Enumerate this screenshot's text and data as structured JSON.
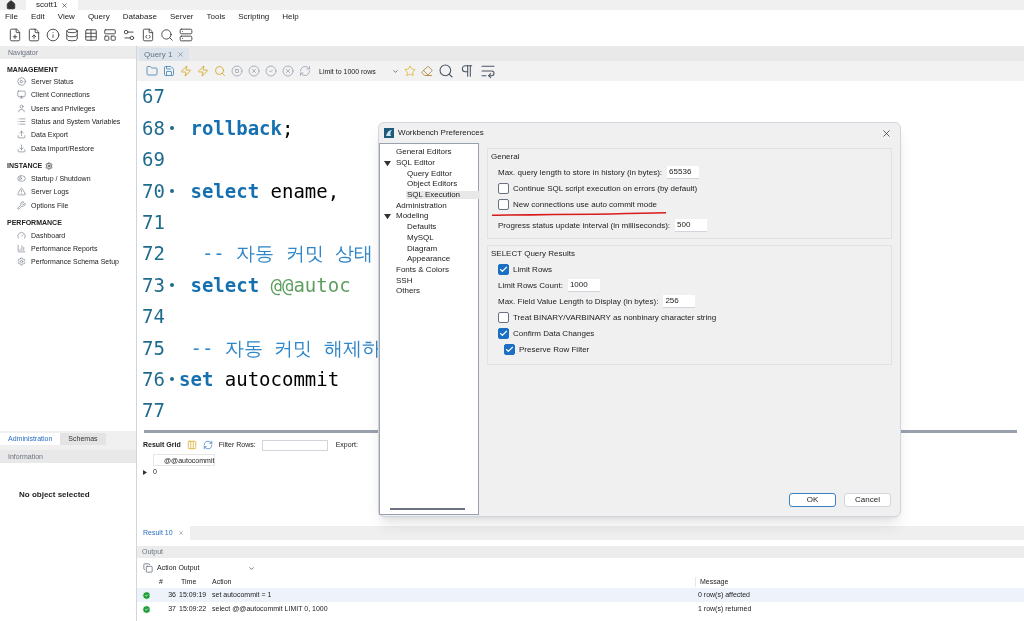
{
  "tabs": [
    {
      "label": "scott1",
      "selected": true
    }
  ],
  "menu": [
    "File",
    "Edit",
    "View",
    "Query",
    "Database",
    "Server",
    "Tools",
    "Scripting",
    "Help"
  ],
  "navigator": {
    "title": "Navigator",
    "sections": [
      {
        "title": "MANAGEMENT",
        "items": [
          "Server Status",
          "Client Connections",
          "Users and Privileges",
          "Status and System Variables",
          "Data Export",
          "Data Import/Restore"
        ]
      },
      {
        "title": "INSTANCE",
        "items": [
          "Startup / Shutdown",
          "Server Logs",
          "Options File"
        ]
      },
      {
        "title": "PERFORMANCE",
        "items": [
          "Dashboard",
          "Performance Reports",
          "Performance Schema Setup"
        ]
      }
    ]
  },
  "sidebar_tabs": [
    {
      "label": "Administration",
      "selected": true
    },
    {
      "label": "Schemas",
      "selected": false
    }
  ],
  "information": {
    "title": "Information",
    "text": "No object selected"
  },
  "query_tab": {
    "label": "Query 1"
  },
  "limit_select": {
    "value": "Limit to 1000 rows"
  },
  "code_lines": [
    {
      "number": "67",
      "marker": false
    },
    {
      "number": "68",
      "marker": true,
      "parts": [
        {
          "kind": "keyword",
          "text": " rollback"
        },
        {
          "kind": "plain",
          "text": ";"
        }
      ]
    },
    {
      "number": "69",
      "marker": false
    },
    {
      "number": "70",
      "marker": true,
      "parts": [
        {
          "kind": "keyword",
          "text": " select"
        },
        {
          "kind": "plain",
          "text": " ename,"
        }
      ]
    },
    {
      "number": "71",
      "marker": false
    },
    {
      "number": "72",
      "marker": false,
      "parts": [
        {
          "kind": "comment",
          "text": "  -- 자동 커밋 상태"
        }
      ]
    },
    {
      "number": "73",
      "marker": true,
      "parts": [
        {
          "kind": "keyword",
          "text": " select"
        },
        {
          "kind": "variable",
          "text": " @@autoc"
        }
      ]
    },
    {
      "number": "74",
      "marker": false
    },
    {
      "number": "75",
      "marker": false,
      "parts": [
        {
          "kind": "comment",
          "text": " -- 자동 커밋 해제하"
        }
      ]
    },
    {
      "number": "76",
      "marker": true,
      "parts": [
        {
          "kind": "keyword",
          "text": "set"
        },
        {
          "kind": "plain",
          "text": " autocommit"
        }
      ]
    },
    {
      "number": "77",
      "marker": false
    }
  ],
  "result": {
    "title": "Result Grid",
    "filter_label": "Filter Rows:",
    "export_label": "Export:",
    "columns": [
      "@@autocommit"
    ],
    "rows": [
      [
        "0"
      ]
    ]
  },
  "result_tab": {
    "label": "Result 10"
  },
  "output": {
    "title": "Output",
    "selector": "Action Output",
    "columns": [
      "#",
      "Time",
      "Action",
      "Message"
    ],
    "rows": [
      {
        "succeeded": true,
        "number": "36",
        "time": "15:09:19",
        "action": "set autocommit = 1",
        "message": "0 row(s) affected"
      },
      {
        "succeeded": true,
        "number": "37",
        "time": "15:09:22",
        "action": "select @@autocommit LIMIT 0, 1000",
        "message": "1 row(s) returned"
      }
    ]
  },
  "dialog": {
    "title": "Workbench Preferences",
    "tree": [
      {
        "label": "General Editors",
        "selected": false
      },
      {
        "label": "SQL Editor",
        "selected": false,
        "expanded": true,
        "children": [
          {
            "label": "Query Editor",
            "selected": false
          },
          {
            "label": "Object Editors",
            "selected": false
          },
          {
            "label": "SQL Execution",
            "selected": true
          }
        ]
      },
      {
        "label": "Administration",
        "selected": false
      },
      {
        "label": "Modeling",
        "selected": false,
        "expanded": true,
        "children": [
          {
            "label": "Defaults",
            "selected": false
          },
          {
            "label": "MySQL",
            "selected": false
          },
          {
            "label": "Diagram",
            "selected": false
          },
          {
            "label": "Appearance",
            "selected": false
          }
        ]
      },
      {
        "label": "Fonts & Colors",
        "selected": false
      },
      {
        "label": "SSH",
        "selected": false
      },
      {
        "label": "Others",
        "selected": false
      }
    ],
    "groups": [
      {
        "title": "General",
        "items": [
          {
            "kind": "field",
            "label": "Max. query length to store in history (in bytes):",
            "value": "65536"
          },
          {
            "kind": "checkbox",
            "label": "Continue SQL script execution on errors (by default)",
            "checked": false,
            "underlined": false
          },
          {
            "kind": "checkbox",
            "label": "New connections use auto commit mode",
            "checked": false,
            "underlined": true
          },
          {
            "kind": "field",
            "label": "Progress status update interval (in milliseconds):",
            "value": "500"
          }
        ]
      },
      {
        "title": "SELECT Query Results",
        "items": [
          {
            "kind": "checkbox",
            "label": "Limit Rows",
            "checked": true,
            "underlined": false
          },
          {
            "kind": "field",
            "label": "Limit Rows Count:",
            "value": "1000"
          },
          {
            "kind": "field",
            "label": "Max. Field Value Length to Display (in bytes):",
            "value": "256"
          },
          {
            "kind": "checkbox",
            "label": "Treat BINARY/VARBINARY as nonbinary character string",
            "checked": false,
            "underlined": false
          },
          {
            "kind": "checkbox",
            "label": "Confirm Data Changes",
            "checked": true,
            "underlined": false
          },
          {
            "kind": "subcheckbox",
            "label": "Preserve Row Filter",
            "checked": true,
            "underlined": false
          }
        ]
      }
    ],
    "buttons": [
      {
        "label": "OK",
        "default": true
      },
      {
        "label": "Cancel",
        "default": false
      }
    ]
  }
}
